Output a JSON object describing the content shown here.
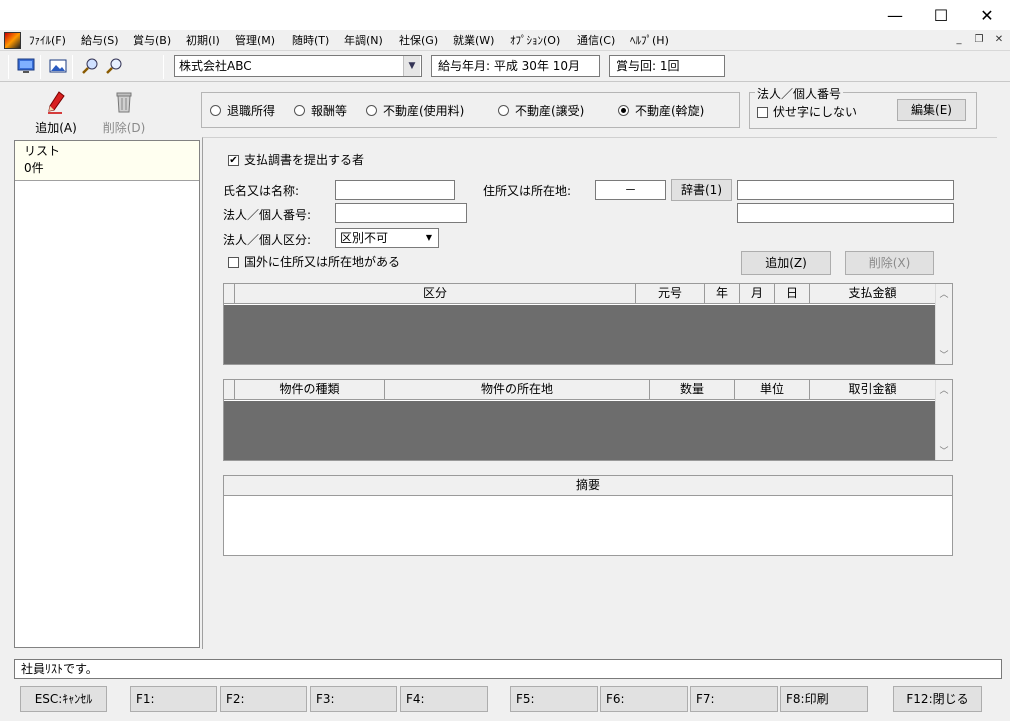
{
  "window": {
    "minimize": "—",
    "maximize": "☐",
    "close": "✕"
  },
  "menu": [
    "ﾌｧｲﾙ(F)",
    "給与(S)",
    "賞与(B)",
    "初期(I)",
    "管理(M)",
    "随時(T)",
    "年調(N)",
    "社保(G)",
    "就業(W)",
    "ｵﾌﾟｼｮﾝ(O)",
    "通信(C)",
    "ﾍﾙﾌﾟ(H)"
  ],
  "mdi": {
    "min": "_",
    "restore": "❐",
    "close": "✕"
  },
  "toolbar": {
    "company": "株式会社ABC",
    "pay_period": "給与年月: 平成 30年 10月",
    "bonus_count": "賞与回: 1回"
  },
  "actions": {
    "add": "追加(A)",
    "delete": "削除(D)"
  },
  "radios": {
    "items": [
      "退職所得",
      "報酬等",
      "不動産(使用料)",
      "不動産(譲受)",
      "不動産(斡旋)"
    ],
    "selected": 4
  },
  "corp": {
    "group_title": "法人／個人番号",
    "no_mask_label": "伏せ字にしない",
    "edit_button": "編集(E)"
  },
  "list": {
    "title": "リスト",
    "count": "0件"
  },
  "form": {
    "submitter_label": "支払調書を提出する者",
    "submitter_checked": "✔",
    "name_label": "氏名又は名称:",
    "name_value": "",
    "address_label": "住所又は所在地:",
    "postal_value": "－",
    "dictionary_button": "辞書(1)",
    "address_value_1": "",
    "address_value_2": "",
    "corp_number_label": "法人／個人番号:",
    "corp_number_value": "",
    "corp_type_label": "法人／個人区分:",
    "corp_type_value": "区別不可",
    "overseas_label": "国外に住所又は所在地がある",
    "add_button": "追加(Z)",
    "delete_button": "削除(X)"
  },
  "grid1": {
    "columns": [
      "区分",
      "元号",
      "年",
      "月",
      "日",
      "支払金額"
    ]
  },
  "grid2": {
    "columns": [
      "物件の種類",
      "物件の所在地",
      "数量",
      "単位",
      "取引金額"
    ]
  },
  "memo": {
    "title": "摘要",
    "value": ""
  },
  "status": "社員ﾘｽﾄです。",
  "fkeys": [
    "ESC:ｷｬﾝｾﾙ",
    "F1:",
    "F2:",
    "F3:",
    "F4:",
    "F5:",
    "F6:",
    "F7:",
    "F8:印刷",
    "F12:閉じる"
  ]
}
